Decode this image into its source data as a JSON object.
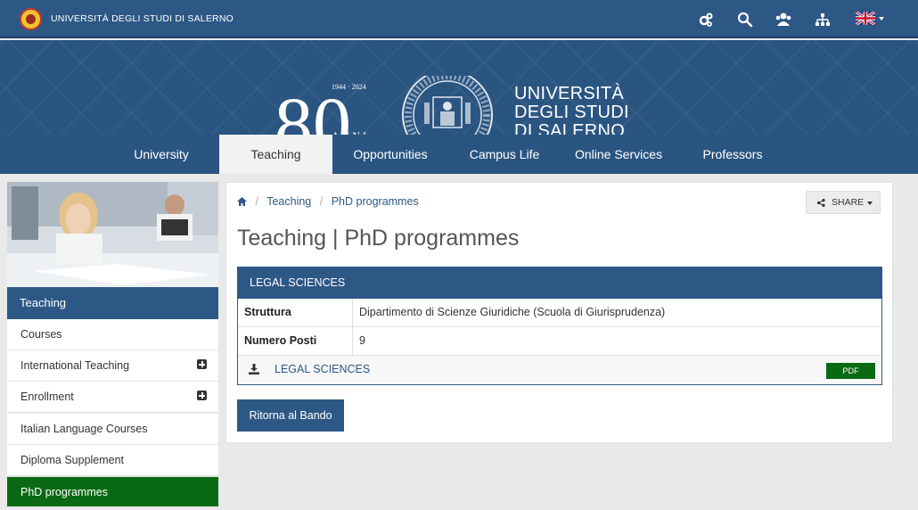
{
  "topbar": {
    "university_name": "UNIVERSITÀ DEGLI STUDI DI SALERNO",
    "tools": [
      "cogs-icon",
      "search-icon",
      "users-icon",
      "sitemap-icon",
      "uk-flag-icon"
    ]
  },
  "banner": {
    "anniversary_number": "80",
    "anniversary_years": "1944 · 2024",
    "anniversary_word": "ANNI",
    "name_line1": "UNIVERSITÀ",
    "name_line2": "DEGLI STUDI",
    "name_line3": "DI SALERNO"
  },
  "mainnav": {
    "items": [
      "University",
      "Teaching",
      "Opportunities",
      "Campus Life",
      "Online Services",
      "Professors"
    ],
    "active": "Teaching"
  },
  "sidebar": {
    "heading": "Teaching",
    "items": [
      {
        "label": "Courses"
      },
      {
        "label": "International Teaching"
      },
      {
        "label": "Enrollment"
      },
      {
        "label": "Italian Language Courses"
      },
      {
        "label": "Diploma Supplement"
      },
      {
        "label": "PhD programmes"
      }
    ]
  },
  "breadcrumb": {
    "items": [
      "Teaching",
      "PhD programmes"
    ]
  },
  "share": {
    "label": "SHARE"
  },
  "page": {
    "title": "Teaching | PhD programmes"
  },
  "programme": {
    "heading": "LEGAL SCIENCES",
    "rows": [
      {
        "key": "Struttura",
        "value": "Dipartimento di Scienze Giuridiche (Scuola di Giurisprudenza)"
      },
      {
        "key": "Numero Posti",
        "value": "9"
      }
    ],
    "download_label": "LEGAL SCIENCES",
    "download_badge": "PDF"
  },
  "back_button": {
    "label": "Ritorna al Bando"
  },
  "colors": {
    "brand_blue": "#2d5886",
    "green": "#0a6a13"
  }
}
